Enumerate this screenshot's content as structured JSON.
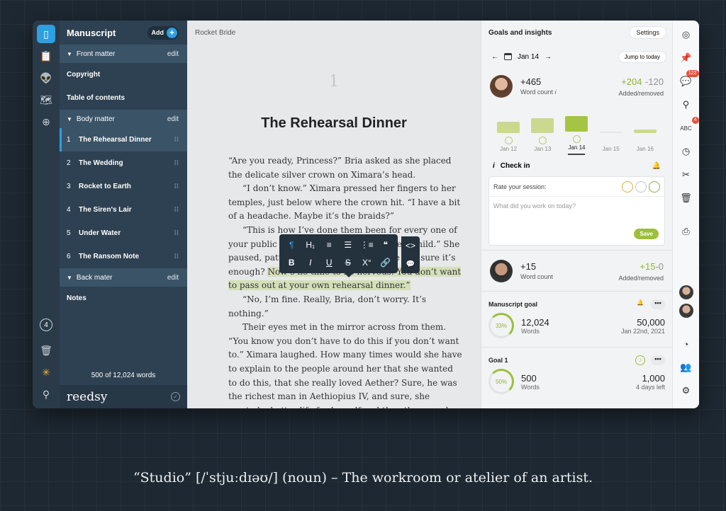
{
  "rail": {
    "badge_count": "4",
    "icons": [
      "book-icon",
      "clipboard-icon",
      "alien-icon",
      "map-icon",
      "plus-icon",
      "trash-icon",
      "sparkle-icon",
      "search-icon"
    ]
  },
  "sidebar": {
    "title": "Manuscript",
    "add_label": "Add",
    "front_matter": {
      "label": "Front matter",
      "edit": "edit"
    },
    "front_items": [
      "Copyright",
      "Table of contents"
    ],
    "body_matter": {
      "label": "Body matter",
      "edit": "edit"
    },
    "chapters": [
      {
        "num": "1",
        "title": "The Rehearsal Dinner"
      },
      {
        "num": "2",
        "title": "The Wedding"
      },
      {
        "num": "3",
        "title": "Rocket to Earth"
      },
      {
        "num": "4",
        "title": "The Siren's Lair"
      },
      {
        "num": "5",
        "title": "Under Water"
      },
      {
        "num": "6",
        "title": "The Ransom Note"
      }
    ],
    "back_matter": {
      "label": "Back mater",
      "edit": "edit"
    },
    "back_items": [
      "Notes"
    ],
    "word_total": "500 of 12,024 words",
    "brand": "reedsy"
  },
  "editor": {
    "doc_tab": "Rocket Bride",
    "page_number": "1",
    "chapter_title": "The Rehearsal Dinner",
    "paragraphs": [
      "“Are you ready, Princess?” Bria asked as she placed the delicate silver crown on Ximara’s head.",
      "“I don’t know.” Ximara pressed her fingers to her temples, just below where the crown hit. “I have a bit of a headache. Maybe it’s the braids?”",
      "“This is how I’ve done them been for every one of your public appearances since you were a child.” She paused, patting Ximara’s shoulder. “Are you sure it’s enough? ",
      "“No, I’m fine. Really, Bria, don’t worry. It’s nothing.”",
      "Their eyes met in the mirror across from them. “You know you don’t have to do this if you don’t want to.” Ximara laughed. How many times would she have to explain to the people around her that she wanted to do this, that she really loved Aether? Sure, he was the richest man in Aethiopius IV, and sure, she wanted a better life for herself and the other people in her galaxy, but she wasn’t marrying him for his money. She was marrying him"
    ],
    "highlight": "Now’s no time to be nervous. You don’t want to pass out at your own rehearsal dinner.”",
    "toolbar": {
      "row1": [
        "¶",
        "H₁",
        "≡",
        "☰",
        "⋮≡",
        "❝"
      ],
      "row1_last": "<>",
      "row2": [
        "B",
        "I",
        "U",
        "S",
        "X°",
        "🔗"
      ],
      "row2_last": "💬"
    }
  },
  "insights": {
    "title": "Goals and insights",
    "settings": "Settings",
    "date": "Jan 14",
    "jump": "Jump to today",
    "me": {
      "value": "+465",
      "label": "Word count",
      "added": "+204",
      "removed": "-120",
      "ar_label": "Added/removed"
    },
    "bars": [
      {
        "date": "Jan 12",
        "value": 465
      },
      {
        "date": "Jan 13",
        "value": 620
      },
      {
        "date": "Jan 14",
        "value": 660
      },
      {
        "date": "Jan 15",
        "value": 0
      },
      {
        "date": "Jan 16",
        "value": 150
      }
    ],
    "checkin": {
      "title": "Check in",
      "rate": "Rate your session:",
      "placeholder": "What did you work on today?",
      "save": "Save"
    },
    "collab": {
      "value": "+15",
      "label": "Word count",
      "added": "+15",
      "removed": "-0",
      "ar_label": "Added/removed"
    },
    "manuscript_goal": {
      "title": "Manuscript goal",
      "pct": "33%",
      "current": "12,024",
      "current_label": "Words",
      "target": "50,000",
      "target_label": "Jan 22nd, 2021",
      "progress": 0.33
    },
    "goal1": {
      "title": "Goal 1",
      "pct": "50%",
      "current": "500",
      "current_label": "Words",
      "target": "1,000",
      "target_label": "4 days left",
      "progress": 0.5
    }
  },
  "tools": {
    "icons": [
      "target-icon",
      "pin-icon",
      "chat-icon",
      "search-icon",
      "spellcheck-icon",
      "clock-icon",
      "scissors-icon",
      "trash-icon",
      "print-icon"
    ],
    "chat_badge": "122",
    "spell_badge": "4",
    "bottom_icons": [
      "feed-icon",
      "users-icon",
      "gear-icon"
    ]
  },
  "caption": "“Studio” [/ˈstjuːdɪəʊ/] (noun) – The workroom or atelier of an artist."
}
